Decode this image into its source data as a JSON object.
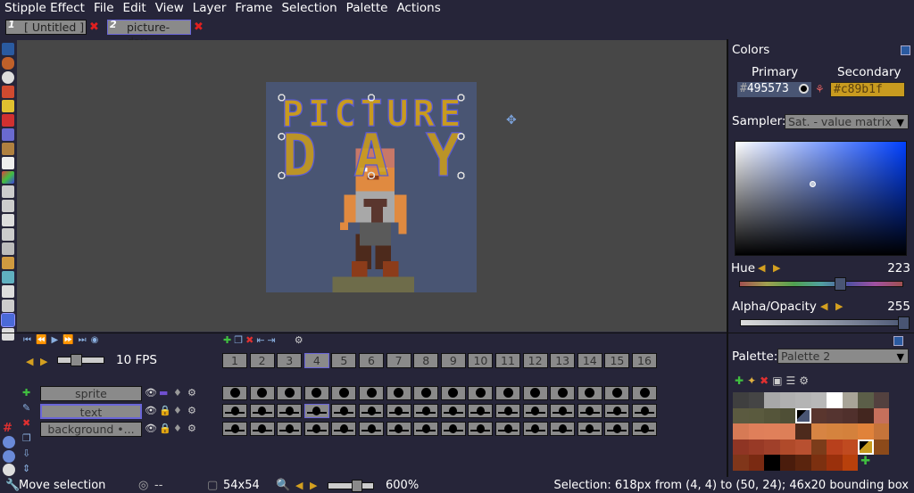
{
  "menu": {
    "app": "Stipple Effect",
    "items": [
      "File",
      "Edit",
      "View",
      "Layer",
      "Frame",
      "Selection",
      "Palette",
      "Actions"
    ]
  },
  "tabs": [
    {
      "num": "1",
      "label": "[ Untitled ]",
      "active": false
    },
    {
      "num": "2",
      "label": "picture-day",
      "active": true
    }
  ],
  "canvas": {
    "art_text_top": "PICTURE",
    "art_text_bottom": "DAY"
  },
  "colors": {
    "title": "Colors",
    "primary_label": "Primary",
    "secondary_label": "Secondary",
    "primary_hex": "#495573",
    "secondary_hex": "#c89b1f",
    "primary_value": "495573",
    "secondary_value": "c89b1f",
    "hash": "#",
    "sampler_label": "Sampler:",
    "sampler_value": "Sat. - value matrix",
    "hue_label": "Hue",
    "hue_value": "223",
    "hue_fraction": 0.62,
    "alpha_label": "Alpha/Opacity",
    "alpha_value": "255",
    "alpha_fraction": 1.0
  },
  "palette": {
    "label": "Palette:",
    "value": "Palette 2",
    "swatches": [
      "#3f3f3f",
      "#454545",
      "#a8a8a8",
      "#b0b0b0",
      "#b4b4b4",
      "#b8b8b8",
      "#ffffff",
      "#a8a498",
      "#5b5e48",
      "#53413f",
      "#5b5a40",
      "#5a5a3e",
      "#55553a",
      "#4f4f36",
      "#495573",
      "#5a362e",
      "#553430",
      "#50302c",
      "#43261f",
      "#c6705c",
      "#d67a55",
      "#df7f5a",
      "#e0805a",
      "#dd7f58",
      "#4d2a1c",
      "#d78443",
      "#d5833e",
      "#d4813c",
      "#e0823a",
      "#c6743a",
      "#8f3524",
      "#983a26",
      "#a0402a",
      "#b04a2a",
      "#b85030",
      "#7c3c1a",
      "#b8401c",
      "#c04a20",
      "#c89b1f",
      "#8c4a1a",
      "#80361a",
      "#7a2a12",
      "#000000",
      "#4a1c0c",
      "#5a240e",
      "#7c3010",
      "#9a300c",
      "#b8400c"
    ],
    "primary_index": 14,
    "secondary_index": 38
  },
  "timeline": {
    "fps_label": "10 FPS",
    "frames": [
      "1",
      "2",
      "3",
      "4",
      "5",
      "6",
      "7",
      "8",
      "9",
      "10",
      "11",
      "12",
      "13",
      "14",
      "15",
      "16"
    ],
    "current_frame": 4,
    "layers": [
      {
        "name": "sprite"
      },
      {
        "name": "text"
      },
      {
        "name": "background •..."
      }
    ],
    "selected_layer": 1
  },
  "status": {
    "tool": "Move selection",
    "cursor": "--",
    "size": "54x54",
    "zoom": "600%",
    "selection": "Selection: 618px from (4, 4) to (50, 24); 46x20 bounding box"
  }
}
